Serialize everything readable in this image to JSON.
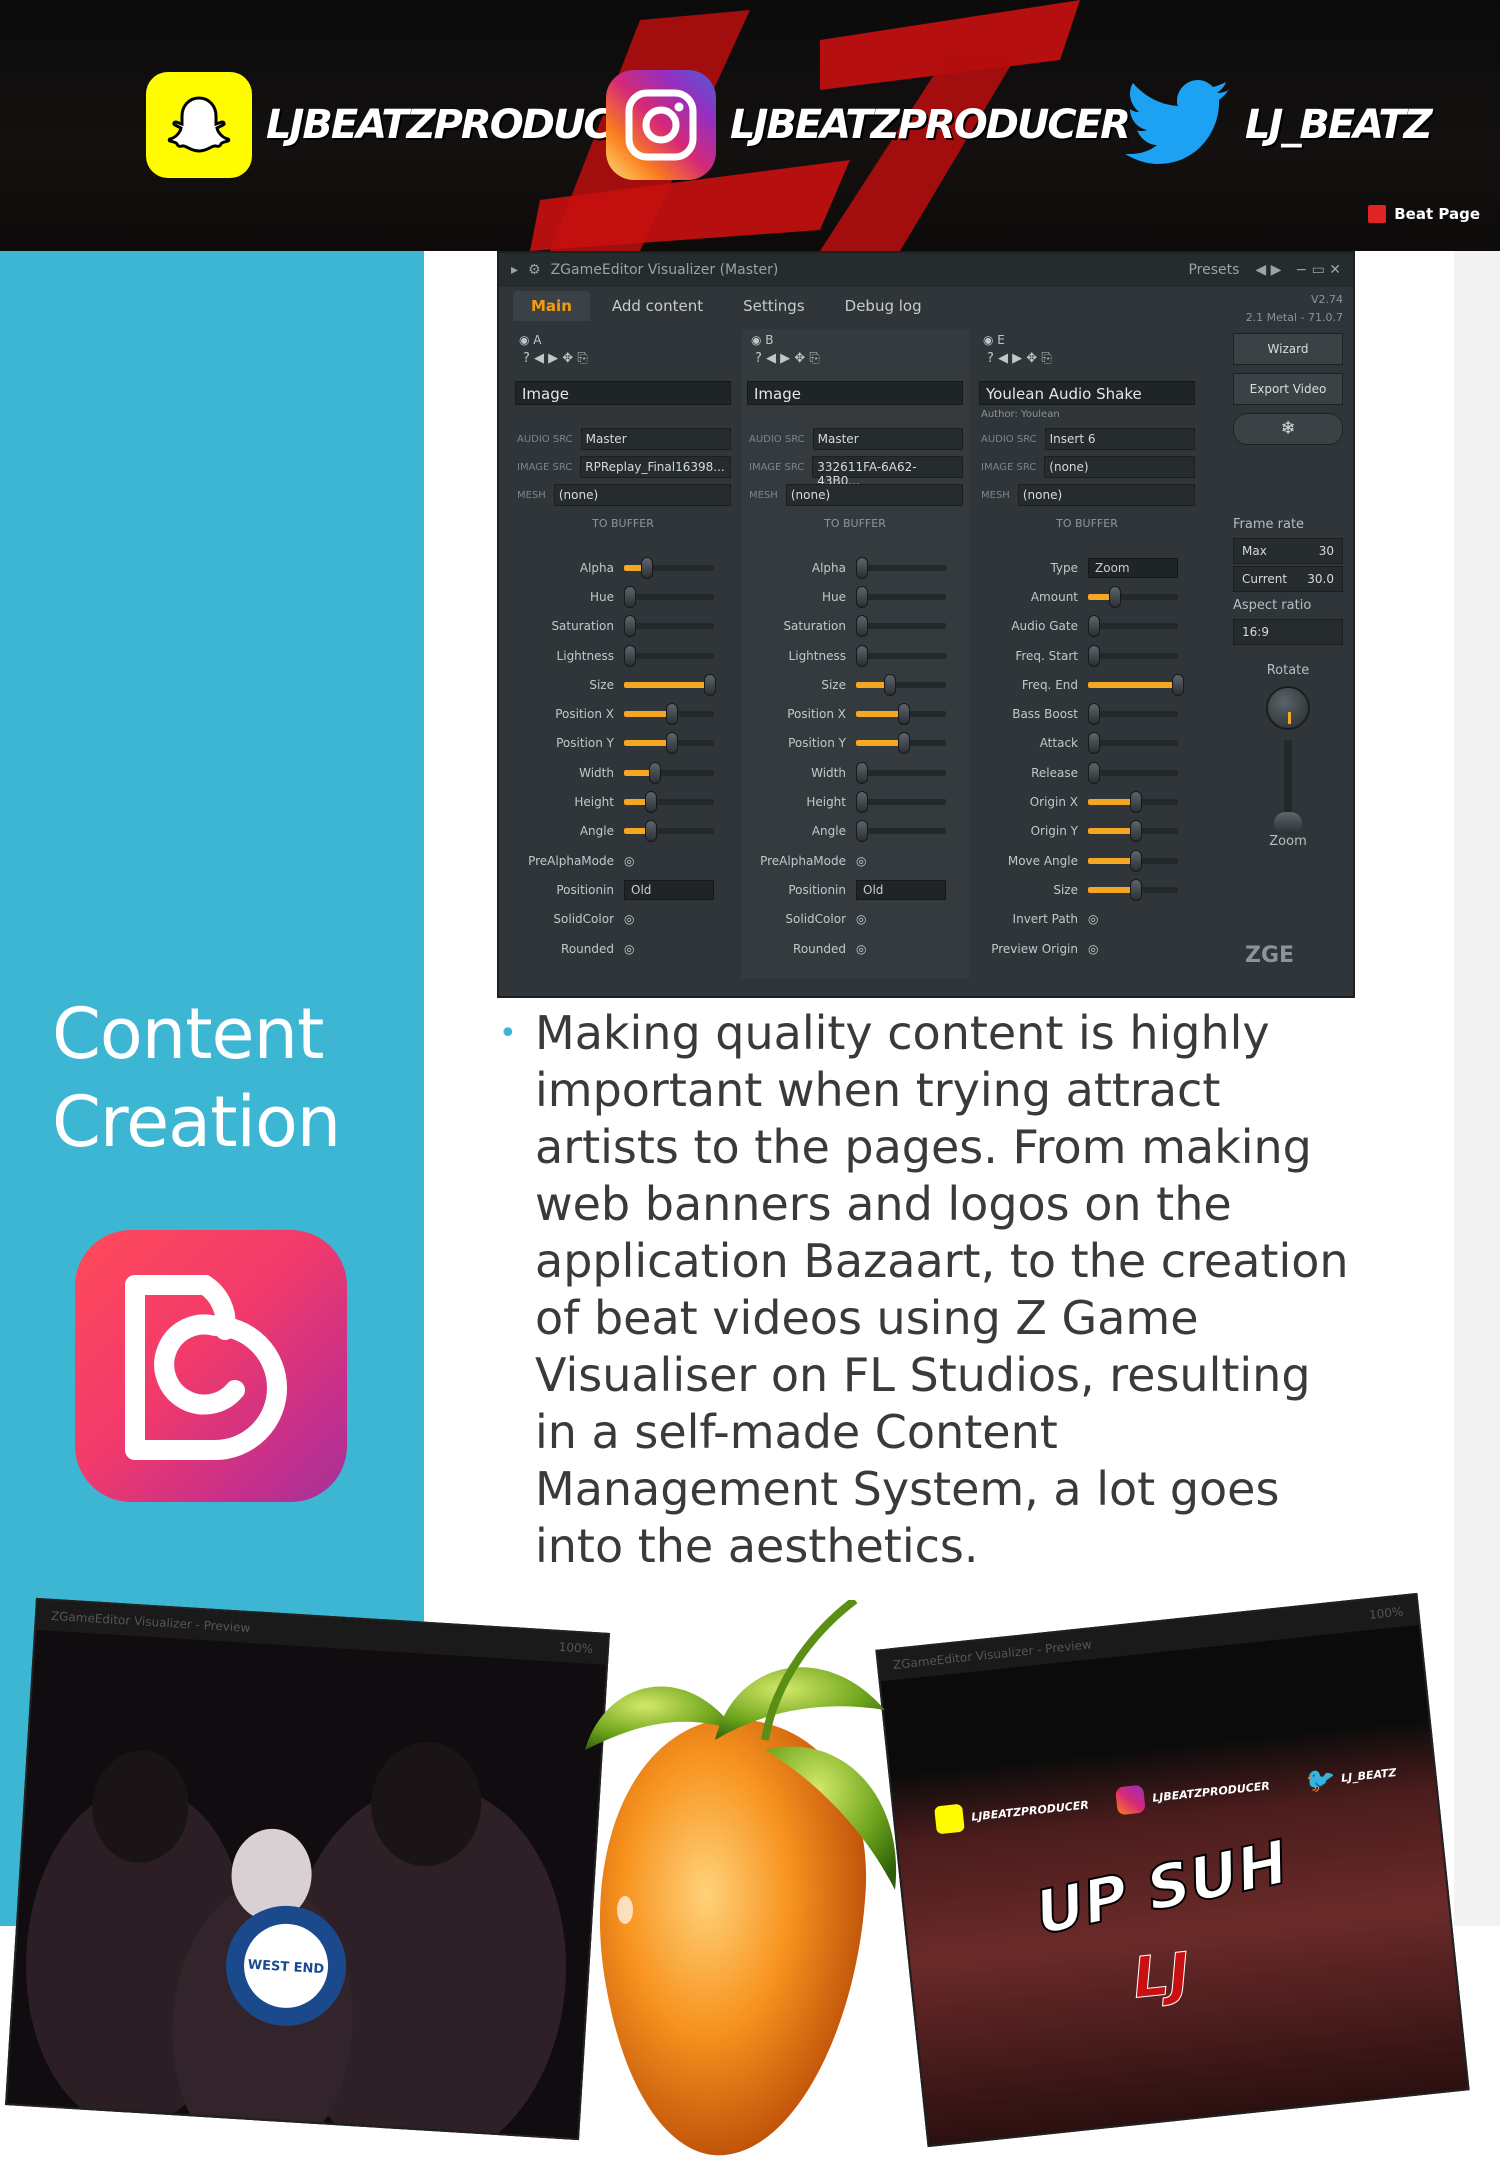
{
  "banner": {
    "snapchat_handle": "LJBEATZPRODUCER",
    "instagram_handle": "LJBEATZPRODUCER",
    "twitter_handle": "LJ_BEATZ",
    "beat_page_label": "Beat Page",
    "colors": {
      "snapchat": "#fffc00",
      "twitter": "#1da1f2",
      "lj_red": "#c81010"
    }
  },
  "visualizer": {
    "title": "ZGameEditor Visualizer (Master)",
    "presets_label": "Presets",
    "tabs": [
      "Main",
      "Add content",
      "Settings",
      "Debug log"
    ],
    "active_tab": "Main",
    "version": "V2.74",
    "build": "2.1 Metal - 71.0.7",
    "columns": [
      {
        "id": "A",
        "effect": "Image",
        "author": "",
        "sources": [
          {
            "label": "AUDIO SRC",
            "value": "Master"
          },
          {
            "label": "IMAGE SRC",
            "value": "RPReplay_Final16398..."
          },
          {
            "label": "MESH",
            "value": "(none)"
          }
        ],
        "to_buffer": "TO BUFFER",
        "sliders": [
          {
            "label": "Alpha",
            "value": 0.2
          },
          {
            "label": "Hue",
            "value": 0
          },
          {
            "label": "Saturation",
            "value": 0
          },
          {
            "label": "Lightness",
            "value": 0
          },
          {
            "label": "Size",
            "value": 0.95
          },
          {
            "label": "Position X",
            "value": 0.5
          },
          {
            "label": "Position Y",
            "value": 0.5
          },
          {
            "label": "Width",
            "value": 0.3
          },
          {
            "label": "Height",
            "value": 0.25
          },
          {
            "label": "Angle",
            "value": 0.25
          }
        ],
        "prealpha_label": "PreAlphaMode",
        "position_label": "Positionin",
        "position_value": "Old",
        "solidcolor_label": "SolidColor",
        "rounded_label": "Rounded"
      },
      {
        "id": "B",
        "effect": "Image",
        "author": "",
        "sources": [
          {
            "label": "AUDIO SRC",
            "value": "Master"
          },
          {
            "label": "IMAGE SRC",
            "value": "332611FA-6A62-43B0..."
          },
          {
            "label": "MESH",
            "value": "(none)"
          }
        ],
        "to_buffer": "TO BUFFER",
        "sliders": [
          {
            "label": "Alpha",
            "value": 0
          },
          {
            "label": "Hue",
            "value": 0
          },
          {
            "label": "Saturation",
            "value": 0
          },
          {
            "label": "Lightness",
            "value": 0
          },
          {
            "label": "Size",
            "value": 0.33
          },
          {
            "label": "Position X",
            "value": 0.5
          },
          {
            "label": "Position Y",
            "value": 0.5
          },
          {
            "label": "Width",
            "value": 0
          },
          {
            "label": "Height",
            "value": 0
          },
          {
            "label": "Angle",
            "value": 0
          }
        ],
        "prealpha_label": "PreAlphaMode",
        "position_label": "Positionin",
        "position_value": "Old",
        "solidcolor_label": "SolidColor",
        "rounded_label": "Rounded"
      },
      {
        "id": "E",
        "effect": "Youlean Audio Shake",
        "author": "Author: Youlean",
        "sources": [
          {
            "label": "AUDIO SRC",
            "value": "Insert 6"
          },
          {
            "label": "IMAGE SRC",
            "value": "(none)"
          },
          {
            "label": "MESH",
            "value": "(none)"
          }
        ],
        "to_buffer": "TO BUFFER",
        "type_label": "Type",
        "type_value": "Zoom",
        "sliders": [
          {
            "label": "Amount",
            "value": 0.25
          },
          {
            "label": "Audio Gate",
            "value": 0
          },
          {
            "label": "Freq. Start",
            "value": 0
          },
          {
            "label": "Freq. End",
            "value": 1
          },
          {
            "label": "Bass Boost",
            "value": 0
          },
          {
            "label": "Attack",
            "value": 0
          },
          {
            "label": "Release",
            "value": 0
          },
          {
            "label": "Origin X",
            "value": 0.5
          },
          {
            "label": "Origin Y",
            "value": 0.5
          },
          {
            "label": "Move Angle",
            "value": 0.5
          },
          {
            "label": "Size",
            "value": 0.5
          }
        ],
        "invert_label": "Invert Path",
        "preview_label": "Preview Origin"
      }
    ],
    "side": {
      "wizard": "Wizard",
      "export": "Export Video",
      "frame_rate_label": "Frame rate",
      "max_label": "Max",
      "max_value": "30",
      "current_label": "Current",
      "current_value": "30.0",
      "aspect_label": "Aspect ratio",
      "aspect_value": "16:9",
      "rotate_label": "Rotate",
      "zoom_label": "Zoom",
      "logo_text": "ZGE"
    }
  },
  "content": {
    "heading_line1": "Content",
    "heading_line2": "Creation",
    "paragraph": "Making quality content is highly important when trying attract artists to the pages. From making web banners and logos on the application Bazaart, to the creation of beat videos using Z Game Visualiser on FL Studios, resulting in a self-made Content Management System, a lot goes into the aesthetics."
  },
  "screenshots": {
    "preview_title": "ZGameEditor Visualizer - Preview",
    "zoom_label": "100%",
    "left_logo_text": "WEST END",
    "right_handles": [
      "LJBEATZPRODUCER",
      "LJBEATZPRODUCER",
      "LJ_BEATZ"
    ],
    "right_title": "UP SUH",
    "right_mark": "LJ"
  }
}
